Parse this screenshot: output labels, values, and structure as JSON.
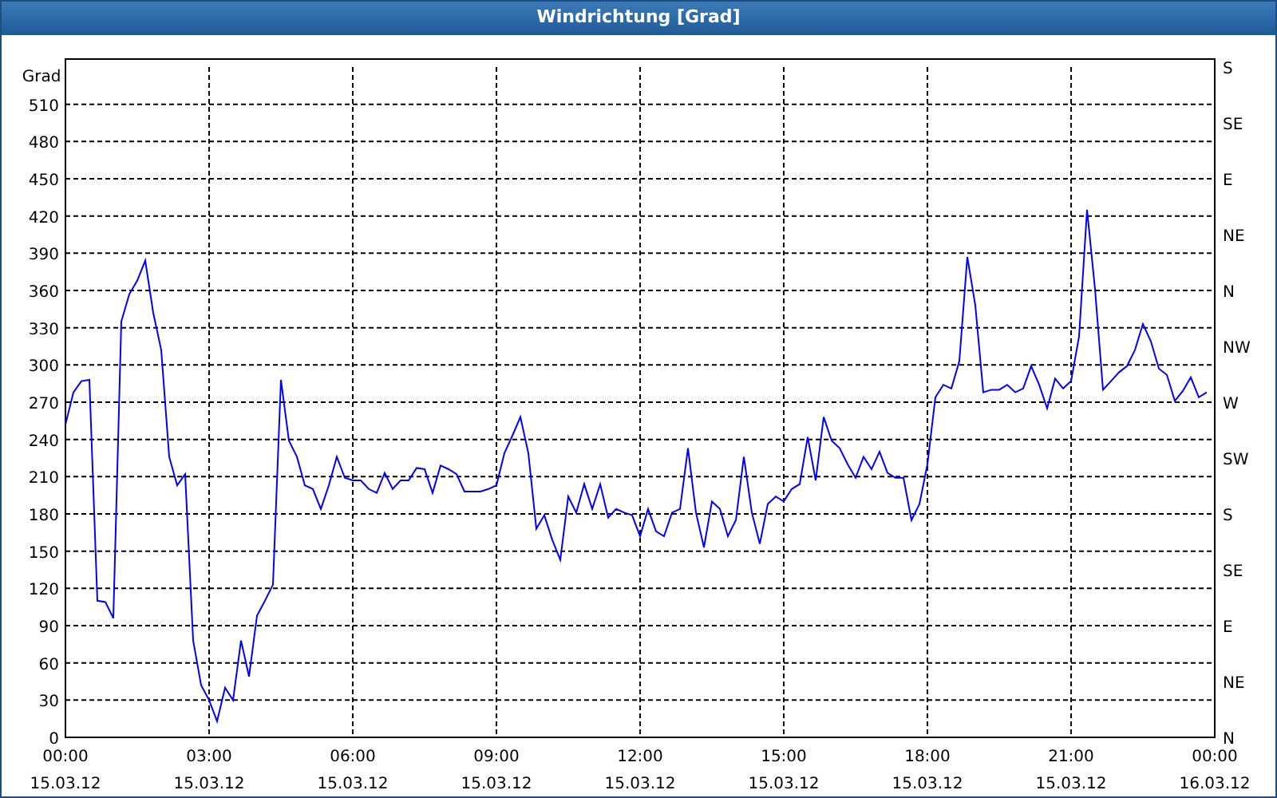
{
  "window": {
    "title": "Windrichtung [Grad]"
  },
  "chart": {
    "compass_labels": [
      "S",
      "SE",
      "E",
      "NE",
      "N",
      "NW",
      "W",
      "SW",
      "S",
      "SE",
      "E",
      "NE",
      "N"
    ],
    "chart_data": {
      "type": "line",
      "grid": true,
      "ylabel": "Grad",
      "ylim": [
        0,
        540
      ],
      "yticks": [
        0,
        30,
        60,
        90,
        120,
        150,
        180,
        210,
        240,
        270,
        300,
        330,
        360,
        390,
        420,
        450,
        480,
        510
      ],
      "categories": [
        "00:00\n15.03.12",
        null,
        null,
        null,
        null,
        null,
        null,
        null,
        null,
        null,
        null,
        null,
        null,
        null,
        null,
        null,
        null,
        null,
        "03:00\n15.03.12",
        null,
        null,
        null,
        null,
        null,
        null,
        null,
        null,
        null,
        null,
        null,
        null,
        null,
        null,
        null,
        null,
        null,
        "06:00\n15.03.12",
        null,
        null,
        null,
        null,
        null,
        null,
        null,
        null,
        null,
        null,
        null,
        null,
        null,
        null,
        null,
        null,
        null,
        "09:00\n15.03.12",
        null,
        null,
        null,
        null,
        null,
        null,
        null,
        null,
        null,
        null,
        null,
        null,
        null,
        null,
        null,
        null,
        null,
        "12:00\n15.03.12",
        null,
        null,
        null,
        null,
        null,
        null,
        null,
        null,
        null,
        null,
        null,
        null,
        null,
        null,
        null,
        null,
        null,
        "15:00\n15.03.12",
        null,
        null,
        null,
        null,
        null,
        null,
        null,
        null,
        null,
        null,
        null,
        null,
        null,
        null,
        null,
        null,
        null,
        "18:00\n15.03.12",
        null,
        null,
        null,
        null,
        null,
        null,
        null,
        null,
        null,
        null,
        null,
        null,
        null,
        null,
        null,
        null,
        null,
        "21:00\n15.03.12",
        null,
        null,
        null,
        null,
        null,
        null,
        null,
        null,
        null,
        null,
        null,
        null,
        null,
        null,
        null,
        null,
        null,
        "00:00\n16.03.12"
      ],
      "series": [
        {
          "color": "#0000ff",
          "values": [
            252,
            278,
            287,
            288,
            110,
            109,
            96,
            335,
            357,
            368,
            384,
            342,
            312,
            226,
            203,
            212,
            78,
            42,
            30,
            13,
            40,
            30,
            78,
            49,
            98,
            110,
            123,
            288,
            239,
            226,
            203,
            200,
            184,
            203,
            226,
            209,
            207,
            207,
            200,
            197,
            213,
            200,
            207,
            207,
            217,
            216,
            197,
            219,
            216,
            212,
            198,
            198,
            198,
            200,
            203,
            229,
            243,
            258,
            229,
            168,
            179,
            159,
            143,
            194,
            181,
            204,
            184,
            204,
            177,
            184,
            181,
            179,
            162,
            184,
            166,
            162,
            181,
            184,
            233,
            181,
            153,
            190,
            184,
            162,
            175,
            226,
            181,
            156,
            188,
            194,
            190,
            200,
            204,
            242,
            207,
            258,
            239,
            233,
            220,
            209,
            226,
            216,
            230,
            213,
            209,
            209,
            175,
            188,
            220,
            274,
            284,
            281,
            303,
            387,
            348,
            278,
            280,
            280,
            284,
            278,
            281,
            299,
            284,
            265,
            289,
            281,
            287,
            323,
            425,
            361,
            280,
            287,
            294,
            299,
            312,
            333,
            319,
            297,
            292,
            271,
            279,
            290,
            274,
            278,
            null
          ]
        }
      ]
    }
  }
}
